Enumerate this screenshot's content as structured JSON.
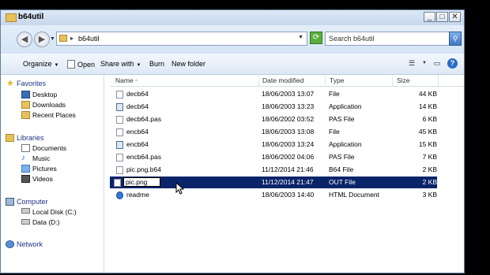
{
  "window": {
    "title": "b64util"
  },
  "address": {
    "path": "b64util",
    "search_placeholder": "Search b64util"
  },
  "toolbar": {
    "organize": "Organize",
    "open": "Open",
    "share_with": "Share with",
    "burn": "Burn",
    "new_folder": "New folder"
  },
  "nav": {
    "favorites": "Favorites",
    "favorites_items": [
      "Desktop",
      "Downloads",
      "Recent Places"
    ],
    "libraries": "Libraries",
    "libraries_items": [
      "Documents",
      "Music",
      "Pictures",
      "Videos"
    ],
    "computer": "Computer",
    "computer_items": [
      "Local Disk (C:)",
      "Data (D:)"
    ],
    "network": "Network"
  },
  "columns": {
    "name": "Name",
    "date": "Date modified",
    "type": "Type",
    "size": "Size"
  },
  "files": [
    {
      "name": "decb64",
      "date": "18/06/2003 13:07",
      "type": "File",
      "size": "44 KB",
      "icon": "file-icon"
    },
    {
      "name": "decb64",
      "date": "18/06/2003 13:23",
      "type": "Application",
      "size": "14 KB",
      "icon": "application-icon"
    },
    {
      "name": "decb64.pas",
      "date": "18/06/2002 03:52",
      "type": "PAS File",
      "size": "6 KB",
      "icon": "file-icon"
    },
    {
      "name": "encb64",
      "date": "18/06/2003 13:08",
      "type": "File",
      "size": "45 KB",
      "icon": "file-icon"
    },
    {
      "name": "encb64",
      "date": "18/06/2003 13:24",
      "type": "Application",
      "size": "15 KB",
      "icon": "application-icon"
    },
    {
      "name": "encb64.pas",
      "date": "18/06/2002 04:06",
      "type": "PAS File",
      "size": "7 KB",
      "icon": "file-icon"
    },
    {
      "name": "pic.png.b64",
      "date": "11/12/2014 21:46",
      "type": "B64 File",
      "size": "2 KB",
      "icon": "file-icon"
    },
    {
      "name": "pic.png",
      "date": "11/12/2014 21:47",
      "type": "OUT File",
      "size": "2 KB",
      "icon": "file-icon"
    },
    {
      "name": "readme",
      "date": "18/06/2003 14:40",
      "type": "HTML Document",
      "size": "3 KB",
      "icon": "html-document-icon"
    }
  ],
  "colors": {
    "selection": "#0a246a",
    "titlebar": "#c7d7ec"
  }
}
